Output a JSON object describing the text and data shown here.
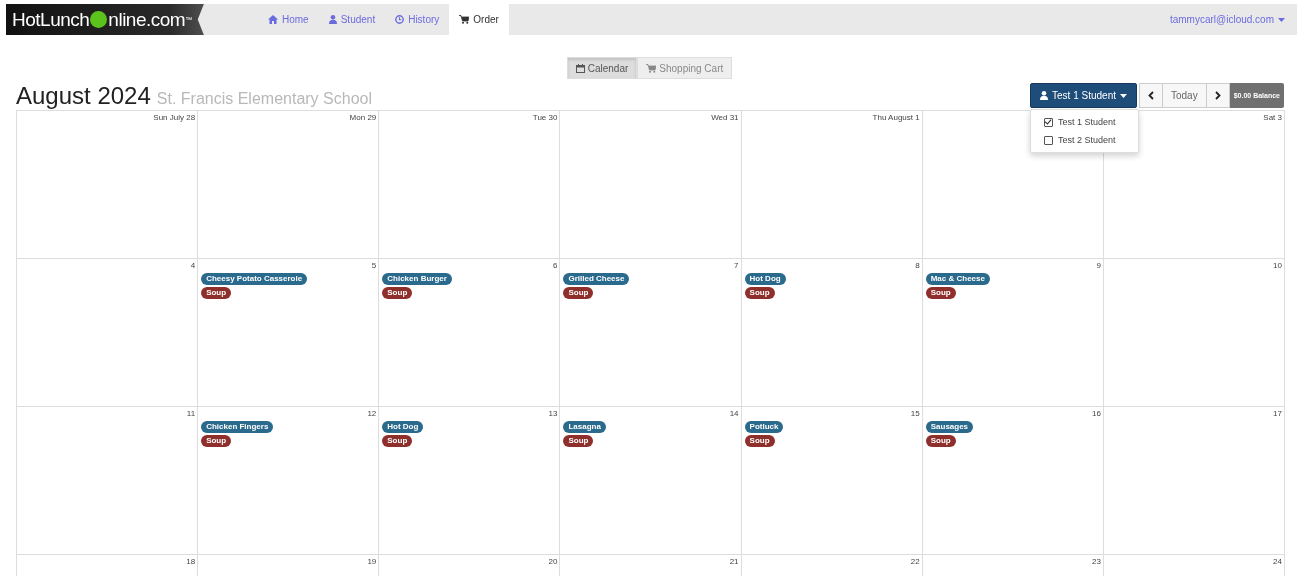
{
  "brand": {
    "name": "HotLunch",
    "suffix": "nline.com",
    "mark": "™"
  },
  "nav": [
    {
      "label": "Home",
      "selected": false
    },
    {
      "label": "Student",
      "selected": false
    },
    {
      "label": "History",
      "selected": false
    },
    {
      "label": "Order",
      "selected": true
    }
  ],
  "account": "tammycarl@icloud.com",
  "views": [
    {
      "label": "Calendar",
      "selected": true
    },
    {
      "label": "Shopping Cart",
      "selected": false
    }
  ],
  "title": "August 2024",
  "school": "St. Francis Elementary School",
  "student_button": "Test 1 Student",
  "today": "Today",
  "balance": "$0.00 Balance",
  "student_menu": [
    {
      "label": "Test 1 Student",
      "checked": true
    },
    {
      "label": "Test 2 Student",
      "checked": false
    }
  ],
  "weeks": [
    [
      {
        "kind": "day",
        "label": "Sun July 28"
      },
      {
        "kind": "day",
        "label": "Mon 29"
      },
      {
        "kind": "day",
        "label": "Tue 30"
      },
      {
        "kind": "day",
        "label": "Wed 31"
      },
      {
        "kind": "day",
        "label": "Thu August 1"
      },
      {
        "kind": "blank"
      },
      {
        "kind": "day",
        "label": "Sat 3"
      }
    ],
    [
      {
        "label": "4"
      },
      {
        "label": "5",
        "events": [
          {
            "name": "Cheesy Potato Casserole",
            "color": "#2a6a8c"
          },
          {
            "name": "Soup",
            "color": "#8f2f2c"
          }
        ]
      },
      {
        "label": "6",
        "events": [
          {
            "name": "Chicken Burger",
            "color": "#2a6a8c"
          },
          {
            "name": "Soup",
            "color": "#8f2f2c"
          }
        ]
      },
      {
        "label": "7",
        "events": [
          {
            "name": "Grilled Cheese",
            "color": "#2a6a8c"
          },
          {
            "name": "Soup",
            "color": "#8f2f2c"
          }
        ]
      },
      {
        "label": "8",
        "events": [
          {
            "name": "Hot Dog",
            "color": "#2a6a8c"
          },
          {
            "name": "Soup",
            "color": "#8f2f2c"
          }
        ]
      },
      {
        "label": "9",
        "events": [
          {
            "name": "Mac & Cheese",
            "color": "#2a6a8c"
          },
          {
            "name": "Soup",
            "color": "#8f2f2c"
          }
        ]
      },
      {
        "label": "10"
      }
    ],
    [
      {
        "label": "11"
      },
      {
        "label": "12",
        "events": [
          {
            "name": "Chicken Fingers",
            "color": "#2a6a8c"
          },
          {
            "name": "Soup",
            "color": "#8f2f2c"
          }
        ]
      },
      {
        "label": "13",
        "events": [
          {
            "name": "Hot Dog",
            "color": "#2a6a8c"
          },
          {
            "name": "Soup",
            "color": "#8f2f2c"
          }
        ]
      },
      {
        "label": "14",
        "events": [
          {
            "name": "Lasagna",
            "color": "#2a6a8c"
          },
          {
            "name": "Soup",
            "color": "#8f2f2c"
          }
        ]
      },
      {
        "label": "15",
        "events": [
          {
            "name": "Potluck",
            "color": "#2a6a8c"
          },
          {
            "name": "Soup",
            "color": "#8f2f2c"
          }
        ]
      },
      {
        "label": "16",
        "events": [
          {
            "name": "Sausages",
            "color": "#2a6a8c"
          },
          {
            "name": "Soup",
            "color": "#8f2f2c"
          }
        ]
      },
      {
        "label": "17"
      }
    ],
    [
      {
        "label": "18"
      },
      {
        "label": "19"
      },
      {
        "label": "20"
      },
      {
        "label": "21"
      },
      {
        "label": "22"
      },
      {
        "label": "23"
      },
      {
        "label": "24"
      }
    ]
  ]
}
